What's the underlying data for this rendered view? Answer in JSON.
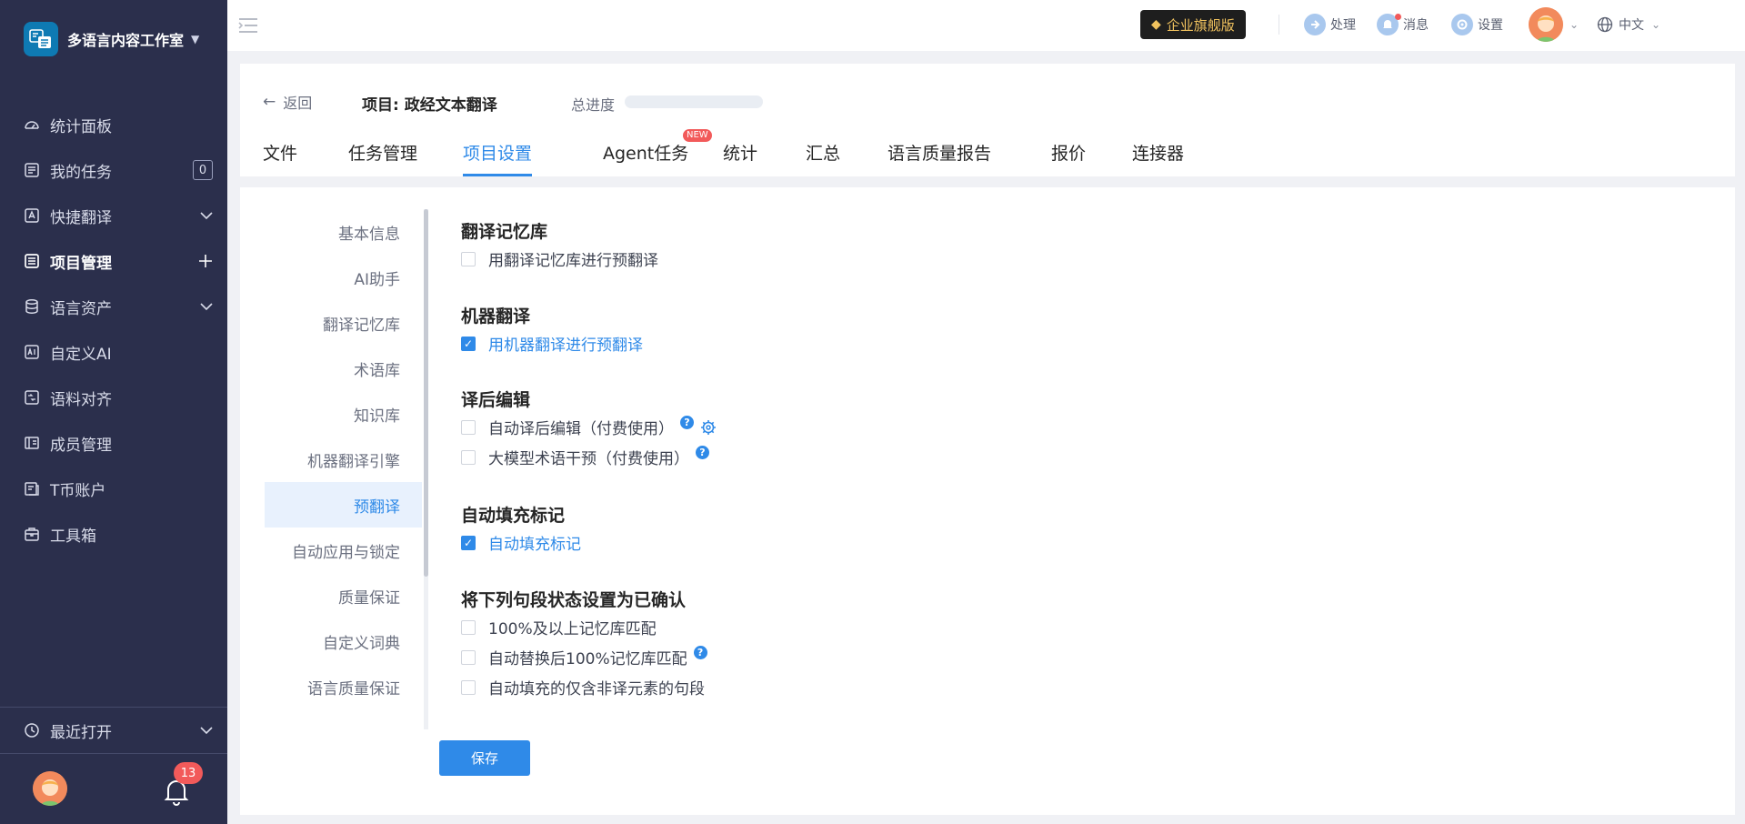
{
  "sidebar": {
    "workspace_name": "多语言内容工作室",
    "items": [
      {
        "label": "统计面板"
      },
      {
        "label": "我的任务",
        "badge": "0"
      },
      {
        "label": "快捷翻译"
      },
      {
        "label": "项目管理"
      },
      {
        "label": "语言资产"
      },
      {
        "label": "自定义AI"
      },
      {
        "label": "语料对齐"
      },
      {
        "label": "成员管理"
      },
      {
        "label": "T币账户"
      },
      {
        "label": "工具箱"
      }
    ],
    "recent_label": "最近打开",
    "notification_count": "13"
  },
  "topbar": {
    "enterprise_label": "企业旗舰版",
    "process_label": "处理",
    "messages_label": "消息",
    "settings_label": "设置",
    "language_label": "中文"
  },
  "header": {
    "back_label": "返回",
    "project_title": "项目: 政经文本翻译",
    "progress_label": "总进度",
    "progress_value": 0,
    "new_badge": "NEW",
    "tabs": [
      {
        "label": "文件"
      },
      {
        "label": "任务管理"
      },
      {
        "label": "项目设置"
      },
      {
        "label": "Agent任务"
      },
      {
        "label": "统计"
      },
      {
        "label": "汇总"
      },
      {
        "label": "语言质量报告"
      },
      {
        "label": "报价"
      },
      {
        "label": "连接器"
      }
    ]
  },
  "settings_nav": [
    {
      "label": "基本信息"
    },
    {
      "label": "AI助手"
    },
    {
      "label": "翻译记忆库"
    },
    {
      "label": "术语库"
    },
    {
      "label": "知识库"
    },
    {
      "label": "机器翻译引擎"
    },
    {
      "label": "预翻译"
    },
    {
      "label": "自动应用与锁定"
    },
    {
      "label": "质量保证"
    },
    {
      "label": "自定义词典"
    },
    {
      "label": "语言质量保证"
    }
  ],
  "sections": {
    "tm": {
      "title": "翻译记忆库",
      "options": [
        {
          "label": "用翻译记忆库进行预翻译",
          "checked": false
        }
      ]
    },
    "mt": {
      "title": "机器翻译",
      "options": [
        {
          "label": "用机器翻译进行预翻译",
          "checked": true
        }
      ]
    },
    "pe": {
      "title": "译后编辑",
      "options": [
        {
          "label": "自动译后编辑（付费使用）",
          "checked": false
        },
        {
          "label": "大模型术语干预（付费使用）",
          "checked": false
        }
      ]
    },
    "autofill": {
      "title": "自动填充标记",
      "options": [
        {
          "label": "自动填充标记",
          "checked": true
        }
      ]
    },
    "confirm": {
      "title": "将下列句段状态设置为已确认",
      "options": [
        {
          "label": "100%及以上记忆库匹配",
          "checked": false
        },
        {
          "label": "自动替换后100%记忆库匹配",
          "checked": false
        },
        {
          "label": "自动填充的仅含非译元素的句段",
          "checked": false
        }
      ]
    }
  },
  "save_label": "保存",
  "help_glyph": "?",
  "colors": {
    "accent": "#2f8ae8",
    "sidebar_bg": "#2b2f4c",
    "enterprise_text": "#f0c25e",
    "badge_red": "#f25a5a"
  }
}
